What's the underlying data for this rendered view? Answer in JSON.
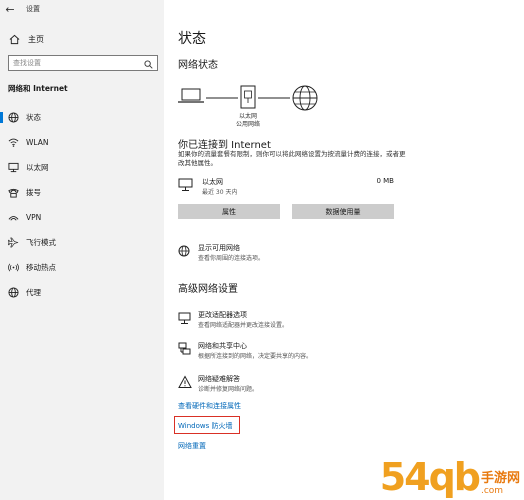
{
  "window": {
    "back_glyph": "←",
    "title": "设置"
  },
  "sidebar": {
    "home_label": "主页",
    "search_placeholder": "查找设置",
    "section_title": "网络和 Internet",
    "items": [
      {
        "label": "状态",
        "icon": "globe-icon",
        "active": true
      },
      {
        "label": "WLAN",
        "icon": "wifi-icon"
      },
      {
        "label": "以太网",
        "icon": "ethernet-icon"
      },
      {
        "label": "拨号",
        "icon": "dialup-icon"
      },
      {
        "label": "VPN",
        "icon": "vpn-icon"
      },
      {
        "label": "飞行模式",
        "icon": "airplane-icon"
      },
      {
        "label": "移动热点",
        "icon": "hotspot-icon"
      },
      {
        "label": "代理",
        "icon": "proxy-globe-icon"
      }
    ]
  },
  "main": {
    "page_title": "状态",
    "network_status_heading": "网络状态",
    "diagram_label_line1": "以太网",
    "diagram_label_line2": "公用网络",
    "connected_title": "你已连接到 Internet",
    "connected_desc": "如果你的流量套餐有限制，则你可以将此网络设置为按流量计费的连接，或者更改其他属性。",
    "ethernet": {
      "name": "以太网",
      "sub": "最近 30 天内",
      "size": "0 MB"
    },
    "buttons": {
      "properties": "属性",
      "data_usage": "数据使用量"
    },
    "show_networks": {
      "title": "显示可用网络",
      "sub": "查看你周围的连接选项。"
    },
    "advanced_heading": "高级网络设置",
    "advanced": [
      {
        "title": "更改适配器选项",
        "sub": "查看网络适配器并更改连接设置。",
        "icon": "adapter-icon"
      },
      {
        "title": "网络和共享中心",
        "sub": "根据所连接到的网络，决定要共享的内容。",
        "icon": "sharing-center-icon"
      },
      {
        "title": "网络疑难解答",
        "sub": "诊断并修复网络问题。",
        "icon": "warning-icon"
      }
    ],
    "links": {
      "hardware": "查看硬件和连接属性",
      "firewall": "Windows 防火墙",
      "reset": "网络重置"
    }
  },
  "watermark": {
    "main": "54qb",
    "cn1": "手游网",
    "cn2": ".com"
  },
  "colors": {
    "accent": "#0078d7",
    "link": "#0067b8",
    "highlight_box": "#d93025",
    "sidebar_bg": "#f2f2f2",
    "watermark": "#f0a020"
  }
}
